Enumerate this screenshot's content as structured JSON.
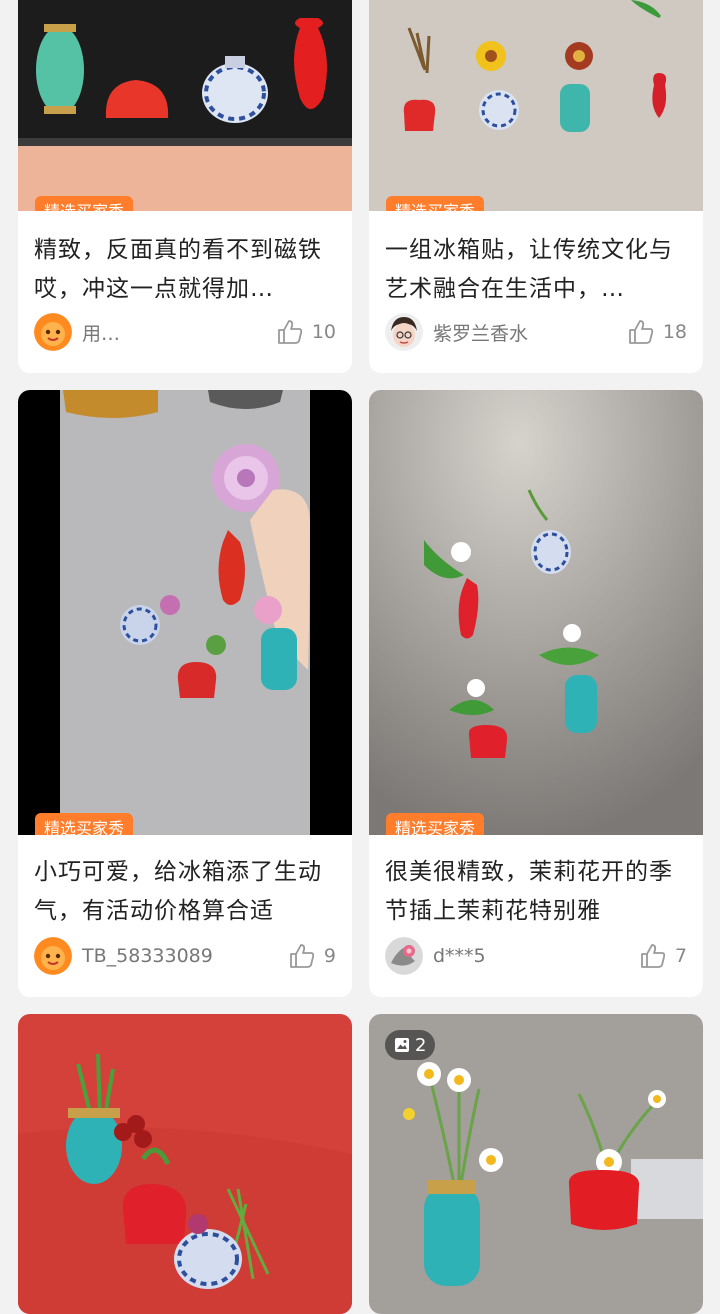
{
  "feed": {
    "cards": [
      {
        "tag": "精选买家秀",
        "title": "精致，反面真的看不到磁铁哎，冲这一点就得加…",
        "user": "用…",
        "likes": "10",
        "avatar": "orange-mascot-avatar"
      },
      {
        "tag": "精选买家秀",
        "title": "一组冰箱贴，让传统文化与艺术融合在生活中，…",
        "user": "紫罗兰香水",
        "likes": "18",
        "avatar": "girl-avatar"
      },
      {
        "tag": "精选买家秀",
        "title": "小巧可爱，给冰箱添了生动气，有活动价格算合适",
        "user": "TB_58333089",
        "likes": "9",
        "avatar": "orange-mascot-avatar"
      },
      {
        "tag": "精选买家秀",
        "title": "很美很精致，茉莉花开的季节插上茉莉花特别雅",
        "user": "d***5",
        "likes": "7",
        "avatar": "flower-avatar"
      },
      {
        "image": "red-tablecloth-vases"
      },
      {
        "image": "fridge-vases-daisies",
        "pic_count": "2"
      }
    ]
  },
  "colors": {
    "tag": "#ff7d2b",
    "background": "#f2f2f2",
    "text": "#222222",
    "meta": "#777777"
  }
}
